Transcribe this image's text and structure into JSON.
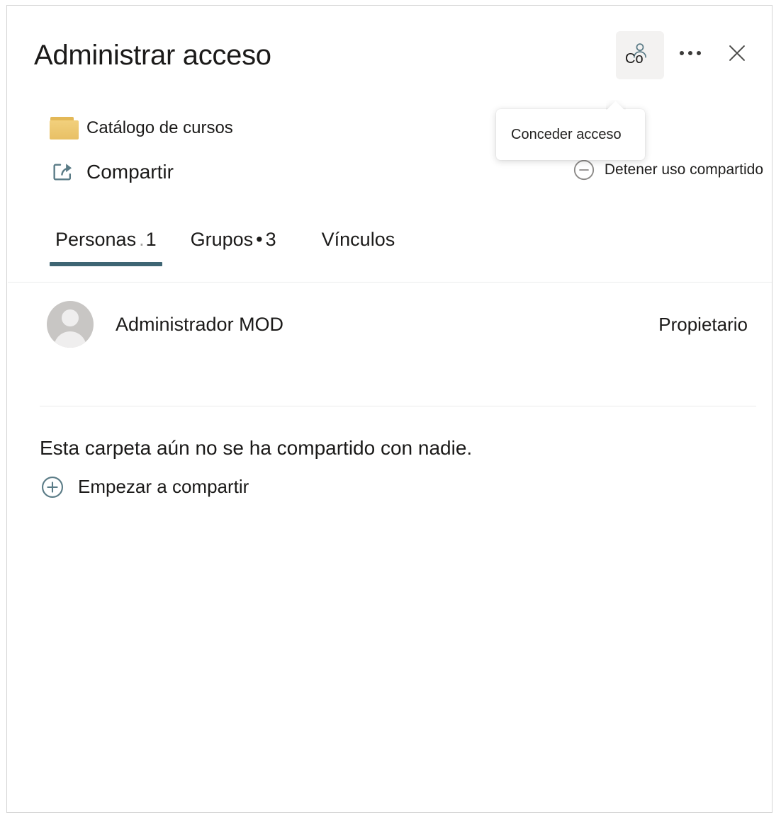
{
  "panel": {
    "title": "Administrar acceso"
  },
  "header": {
    "grant_access_button": {
      "caption": "Co",
      "icon": "person-add-icon",
      "tooltip": "Conceder acceso"
    },
    "more_button_label": "...",
    "close_button_label": "Cerrar"
  },
  "tooltip": {
    "text": "Conceder acceso"
  },
  "meta": {
    "folder": {
      "icon": "folder-icon",
      "label": "Catálogo de cursos"
    },
    "share": {
      "icon": "share-icon",
      "label": "Compartir"
    }
  },
  "stop_sharing": {
    "icon": "minus-circle-icon",
    "label": "Detener uso compartido"
  },
  "tabs": [
    {
      "label": "Personas",
      "separator": ".",
      "count": "1",
      "active": true
    },
    {
      "label": "Grupos",
      "separator": "•",
      "count": "3",
      "active": false
    },
    {
      "label": "Vínculos",
      "separator": "",
      "count": "",
      "active": false
    }
  ],
  "people": [
    {
      "avatar": "default-person-avatar",
      "name": "Administrador MOD",
      "role": "Propietario"
    }
  ],
  "empty_state": {
    "message": "Esta carpeta aún no se ha compartido con nadie.",
    "action_icon": "plus-circle-icon",
    "action_label": "Empezar a compartir"
  },
  "colors": {
    "accent": "#3e6573",
    "icon_teal": "#5a7b86",
    "folder": "#e8c065",
    "panel_border": "#d4d4d4",
    "button_bg": "#f3f2f1"
  }
}
